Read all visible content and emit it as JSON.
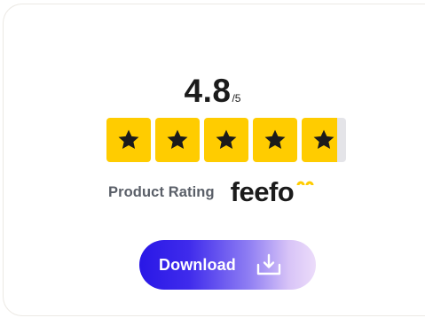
{
  "rating": {
    "score": "4.8",
    "scale": "/5",
    "value": 4.8,
    "max": 5,
    "label": "Product Rating"
  },
  "stars": {
    "count": 5,
    "filled_color": "#ffcc00",
    "empty_color": "#e4e4e8",
    "icon_color": "#1b1b1b",
    "last_star_fill_fraction": 0.8
  },
  "brand": {
    "name": "feefo",
    "accent_color": "#ffcc00"
  },
  "download": {
    "label": "Download",
    "icon": "download-tray-icon",
    "gradient_start": "#2917e6",
    "gradient_end": "#ecdcfa"
  }
}
